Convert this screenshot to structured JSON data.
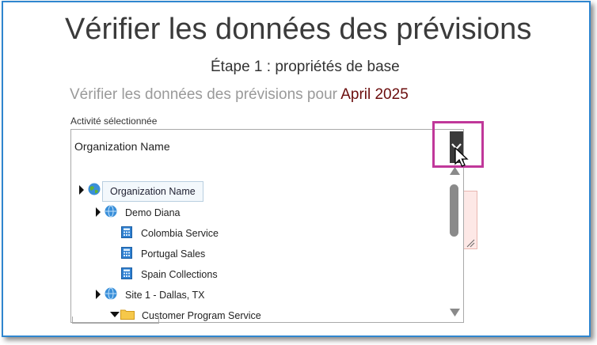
{
  "page": {
    "title": "Vérifier les données des prévisions",
    "step": "Étape 1 : propriétés de base",
    "verify_prefix": "Vérifier les données des prévisions pour ",
    "verify_month": "April 2025",
    "activity_label": "Activité sélectionnée"
  },
  "select": {
    "value": "Organization Name"
  },
  "tree": {
    "root": {
      "label": "Organization Name",
      "icon": "globe-color-icon"
    },
    "nodes": [
      {
        "label": "Demo Diana",
        "icon": "globe-icon"
      },
      {
        "label": "Colombia Service",
        "icon": "calculator-icon"
      },
      {
        "label": "Portugal Sales",
        "icon": "calculator-icon"
      },
      {
        "label": "Spain Collections",
        "icon": "calculator-icon"
      },
      {
        "label": "Site 1 - Dallas, TX",
        "icon": "globe-icon"
      },
      {
        "label": "Customer Program Service",
        "icon": "folder-icon"
      }
    ]
  },
  "colors": {
    "frame_border": "#2f86cf",
    "highlight": "#c0389a",
    "month_text": "#6b0d0d"
  }
}
